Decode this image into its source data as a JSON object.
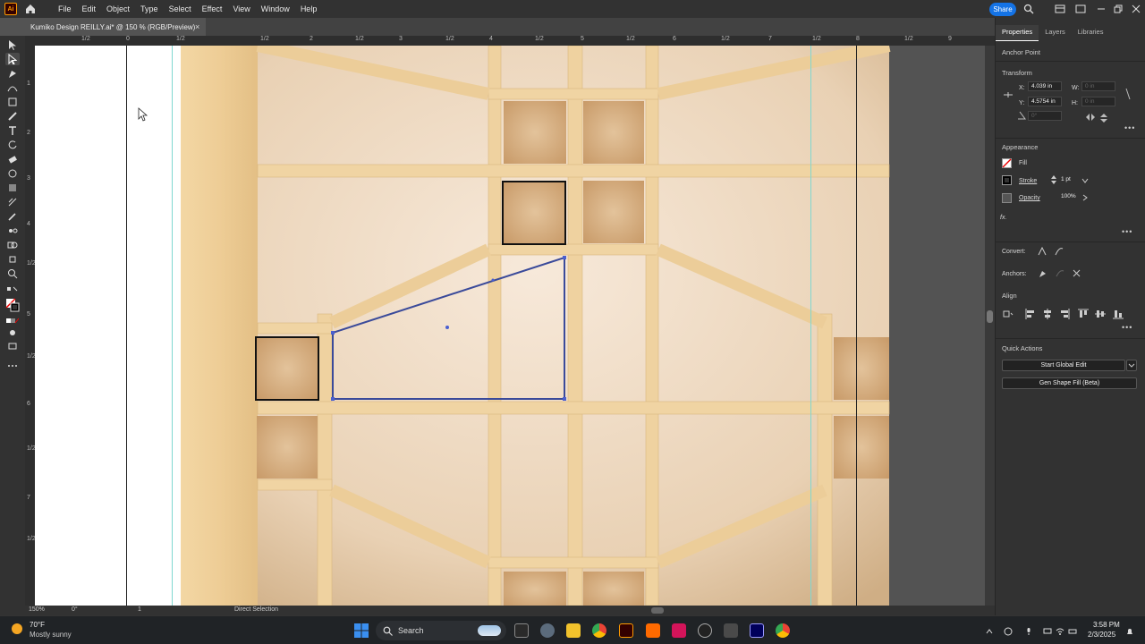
{
  "app": {
    "logo": "Ai"
  },
  "menu": [
    "File",
    "Edit",
    "Object",
    "Type",
    "Select",
    "Effect",
    "View",
    "Window",
    "Help"
  ],
  "topbar": {
    "share": "Share"
  },
  "tab": {
    "title": "Kumiko Design REILLY.ai* @ 150 % (RGB/Preview)",
    "close": "×"
  },
  "ruler_top": [
    "1/2",
    "0",
    "1/2",
    "1/2",
    "2",
    "1/2",
    "3",
    "1/2",
    "4",
    "1/2",
    "5",
    "1/2",
    "6",
    "1/2",
    "7",
    "1/2",
    "8",
    "1/2",
    "9"
  ],
  "ruler_left": [
    "1",
    "2",
    "3",
    "4",
    "1/2",
    "5",
    "1/2",
    "6",
    "1/2",
    "7",
    "1/2"
  ],
  "status": {
    "zoom": "150%",
    "rotate": "0°",
    "artboard": "1",
    "tool": "Direct Selection"
  },
  "panel": {
    "tabs": [
      "Properties",
      "Layers",
      "Libraries"
    ],
    "selection": "Anchor Point",
    "transform": {
      "title": "Transform",
      "x_label": "X:",
      "x": "4.039 in",
      "y_label": "Y:",
      "y": "4.5754 in",
      "w_label": "W:",
      "w": "0 in",
      "h_label": "H:",
      "h": "0 in",
      "angle": "0°"
    },
    "appearance": {
      "title": "Appearance",
      "fill": "Fill",
      "stroke": "Stroke",
      "stroke_weight": "1 pt",
      "opacity": "Opacity",
      "opacity_value": "100%",
      "fx": "fx."
    },
    "convert": "Convert:",
    "anchors": "Anchors:",
    "align": "Align",
    "quick_actions": {
      "title": "Quick Actions",
      "start_global_edit": "Start Global Edit",
      "gen_shape_fill": "Gen Shape Fill (Beta)"
    }
  },
  "taskbar": {
    "weather_temp": "70°F",
    "weather_desc": "Mostly sunny",
    "search": "Search",
    "time": "3:58 PM",
    "date": "2/3/2025"
  },
  "colors": {
    "accent": "#1473e6",
    "selection": "#4a5fd0",
    "wood": "#f0d3a0",
    "guide": "#7fd7d0"
  }
}
